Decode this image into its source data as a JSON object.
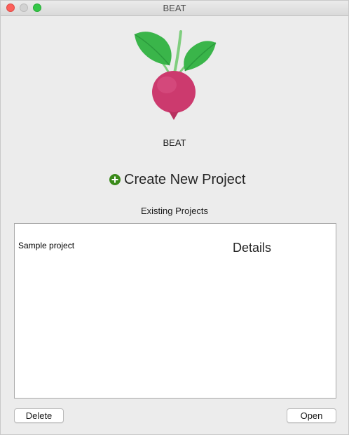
{
  "window": {
    "title": "BEAT"
  },
  "app": {
    "name": "BEAT",
    "logo_icon": "beet-icon"
  },
  "actions": {
    "create_label": "Create New Project",
    "create_icon": "plus-circle-icon",
    "create_icon_color": "#3a8a1a"
  },
  "projects": {
    "section_title": "Existing Projects",
    "items": [
      {
        "name": "Sample project"
      }
    ],
    "details_heading": "Details"
  },
  "footer": {
    "delete_label": "Delete",
    "open_label": "Open"
  },
  "colors": {
    "beet_root": "#cc3a6e",
    "beet_leaf": "#3ab54a",
    "beet_stem": "#7fce7e"
  }
}
